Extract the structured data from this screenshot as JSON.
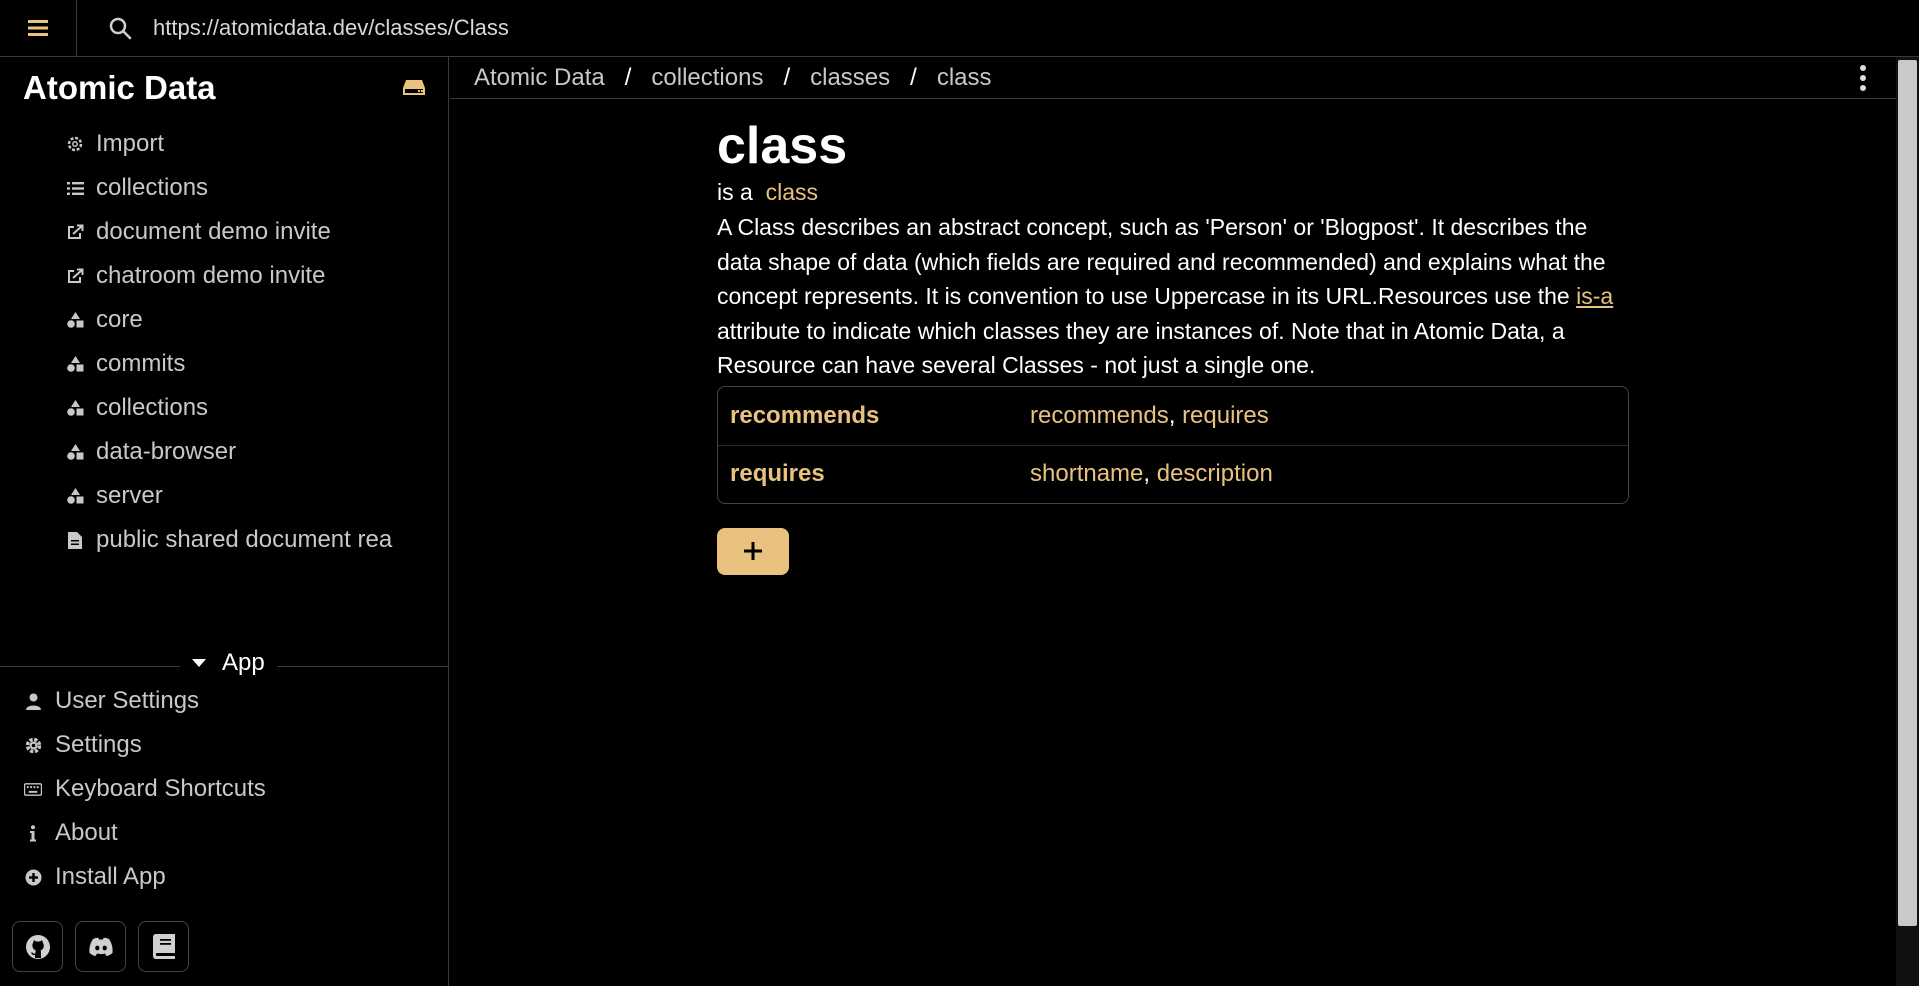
{
  "topbar": {
    "address": "https://atomicdata.dev/classes/Class"
  },
  "sidebar": {
    "brand": "Atomic Data",
    "items": [
      {
        "label": "Import",
        "icon": "gear-icon"
      },
      {
        "label": "collections",
        "icon": "list-icon"
      },
      {
        "label": "document demo invite",
        "icon": "share-icon"
      },
      {
        "label": "chatroom demo invite",
        "icon": "share-icon"
      },
      {
        "label": "core",
        "icon": "shapes-icon"
      },
      {
        "label": "commits",
        "icon": "shapes-icon"
      },
      {
        "label": "collections",
        "icon": "shapes-icon"
      },
      {
        "label": "data-browser",
        "icon": "shapes-icon"
      },
      {
        "label": "server",
        "icon": "shapes-icon"
      },
      {
        "label": "public shared document rea",
        "icon": "document-icon"
      }
    ],
    "app_label": "App",
    "app_items": [
      {
        "label": "User Settings",
        "icon": "user-icon"
      },
      {
        "label": "Settings",
        "icon": "gear-icon"
      },
      {
        "label": "Keyboard Shortcuts",
        "icon": "keyboard-icon"
      },
      {
        "label": "About",
        "icon": "info-icon"
      },
      {
        "label": "Install App",
        "icon": "plus-circle-icon"
      }
    ]
  },
  "breadcrumb": {
    "items": [
      "Atomic Data",
      "collections",
      "classes",
      "class"
    ]
  },
  "resource": {
    "title": "class",
    "is_a_prefix": "is a",
    "is_a_value": "class",
    "desc_part1": "A Class describes an abstract concept, such as 'Person' or 'Blogpost'. It describes the data shape of data (which fields are required and recommended) and explains what the concept represents. It is convention to use Uppercase in its URL.Resources use the ",
    "desc_link": "is-a",
    "desc_part2": " attribute to indicate which classes they are instances of. Note that in Atomic Data, a Resource can have several Classes - not just a single one.",
    "properties": [
      {
        "key": "recommends",
        "values": [
          "recommends",
          "requires"
        ]
      },
      {
        "key": "requires",
        "values": [
          "shortname",
          "description"
        ]
      }
    ],
    "add_label": "+"
  },
  "colors": {
    "accent": "#e8c27e",
    "background": "#000000"
  }
}
